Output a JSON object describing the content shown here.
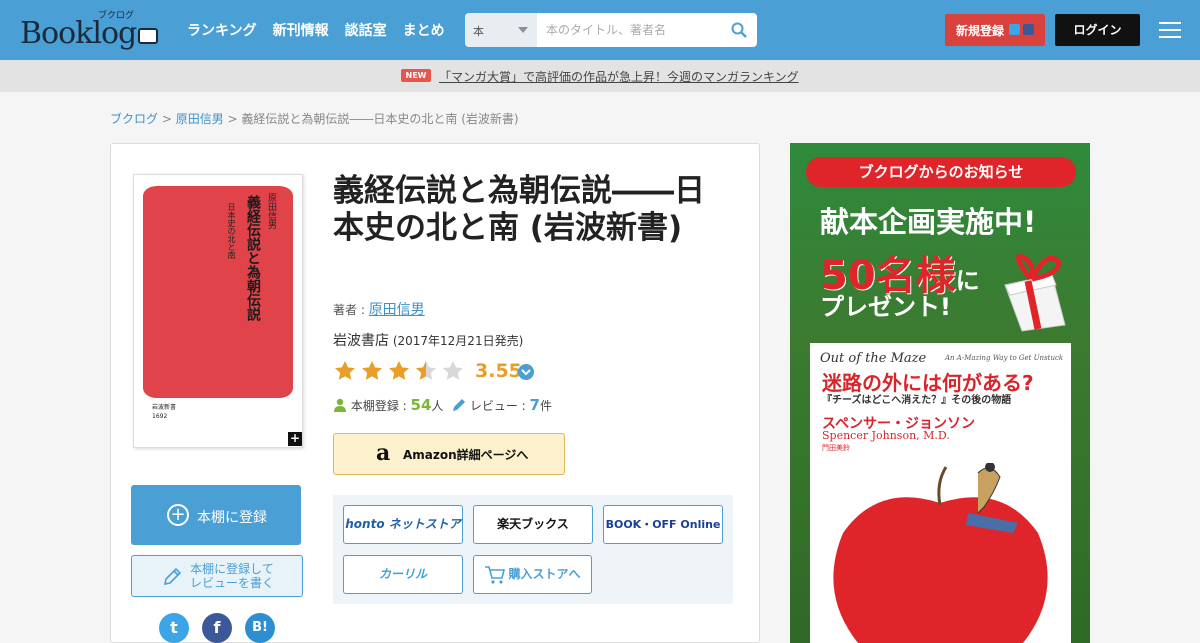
{
  "header": {
    "logo_text": "Booklog",
    "logo_kana": "ブクログ",
    "nav": [
      "ランキング",
      "新刊情報",
      "談話室",
      "まとめ"
    ],
    "search_category": "本",
    "search_placeholder": "本のタイトル、著者名",
    "register_label": "新規登録",
    "login_label": "ログイン"
  },
  "banner": {
    "badge": "NEW",
    "text": "「マンガ大賞」で高評価の作品が急上昇！今週のマンガランキング"
  },
  "breadcrumb": {
    "home": "ブクログ",
    "sep": " > ",
    "author": "原田信男",
    "current": "義経伝説と為朝伝説――日本史の北と南 (岩波新書)"
  },
  "book": {
    "title": "義経伝説と為朝伝説――日本史の北と南 (岩波新書)",
    "author_label": "著者 : ",
    "author": "原田信男",
    "publisher": "岩波書店",
    "release": " (2017年12月21日発売)",
    "rating": "3.55",
    "rating_value": 3.55,
    "shelf_label": "本棚登録 : ",
    "shelf_count": "54",
    "shelf_unit": "人",
    "review_label": "レビュー : ",
    "review_count": "7",
    "review_unit": "件",
    "cover": {
      "author": "原田信男",
      "title": "義経伝説と為朝伝説",
      "subtitle": "日本史の北と南",
      "publisher_mark": "岩波新書\n1692",
      "expand": "+"
    }
  },
  "actions": {
    "add_shelf": "本棚に登録",
    "add_review_line1": "本棚に登録して",
    "add_review_line2": "レビューを書く",
    "amazon": "Amazon詳細ページへ",
    "amazon_mark": "a"
  },
  "share": {
    "twitter": "t",
    "facebook": "f",
    "hatena": "B!"
  },
  "stores": {
    "honto": "honto ネットストア",
    "rakuten": "楽天ブックス",
    "bookoff": "BOOK・OFF Online",
    "calil": "カーリル",
    "buy": "購入ストアへ"
  },
  "ad": {
    "pill": "ブクログからのお知らせ",
    "headline1": "献本企画実施中!",
    "headline2_num": "50名様",
    "headline2_ni": "に",
    "headline3": "プレゼント!",
    "book_en": "Out of the Maze",
    "book_en_sub": "An A-Mazing Way to Get Unstuck",
    "book_title": "迷路の外には何がある?",
    "book_sub": "『チーズはどこへ消えた？』その後の物語",
    "book_author": "スペンサー・ジョンソン",
    "book_author_en": "Spencer Johnson, M.D.",
    "book_translator": "門田美鈴"
  },
  "colors": {
    "header": "#4a9fd5",
    "accent_red": "#d9413c",
    "star": "#e89e27",
    "green": "#7bb736"
  }
}
